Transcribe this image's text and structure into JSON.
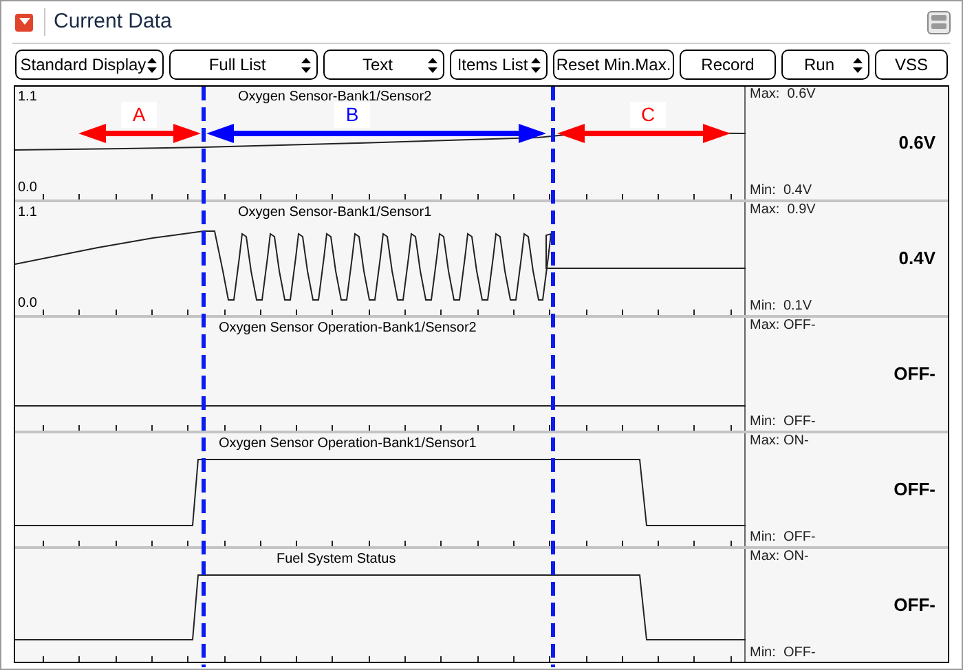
{
  "window": {
    "title": "Current Data"
  },
  "toolbar": [
    {
      "label": "Standard Display",
      "kind": "select"
    },
    {
      "label": "Full List",
      "kind": "select"
    },
    {
      "label": "Text",
      "kind": "select"
    },
    {
      "label": "Items List",
      "kind": "select"
    },
    {
      "label": "Reset Min.Max.",
      "kind": "button"
    },
    {
      "label": "Record",
      "kind": "button"
    },
    {
      "label": "Run",
      "kind": "select"
    },
    {
      "label": "VSS",
      "kind": "button"
    }
  ],
  "panels": [
    {
      "title": "Oxygen Sensor-Bank1/Sensor2",
      "axis_max": "1.1",
      "axis_min": "0.0",
      "max": "Max:  0.6V",
      "value": "0.6V",
      "min": "Min:  0.4V"
    },
    {
      "title": "Oxygen Sensor-Bank1/Sensor1",
      "axis_max": "1.1",
      "axis_min": "0.0",
      "max": "Max:  0.9V",
      "value": "0.4V",
      "min": "Min:  0.1V"
    },
    {
      "title": "Oxygen Sensor Operation-Bank1/Sensor2",
      "max": "Max: OFF-",
      "value": "OFF-",
      "min": "Min:  OFF-"
    },
    {
      "title": "Oxygen Sensor Operation-Bank1/Sensor1",
      "max": "Max: ON-",
      "value": "OFF-",
      "min": "Min:  OFF-"
    },
    {
      "title": "Fuel System Status",
      "max": "Max: ON-",
      "value": "OFF-",
      "min": "Min:  OFF-"
    }
  ],
  "annotations": [
    {
      "label": "A",
      "color": "#ff0000"
    },
    {
      "label": "B",
      "color": "#0000ff"
    },
    {
      "label": "C",
      "color": "#ff0000"
    }
  ]
}
